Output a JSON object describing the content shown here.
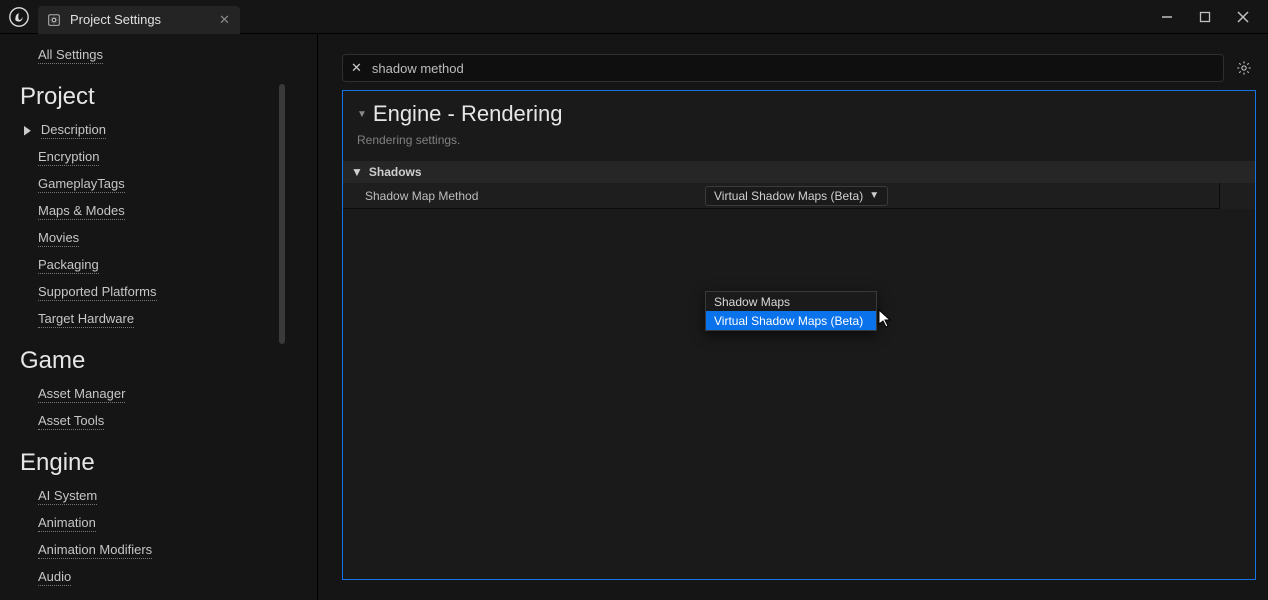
{
  "titlebar": {
    "tab_title": "Project Settings"
  },
  "sidebar": {
    "all_settings": "All Settings",
    "sections": [
      {
        "title": "Project",
        "items": [
          "Description",
          "Encryption",
          "GameplayTags",
          "Maps & Modes",
          "Movies",
          "Packaging",
          "Supported Platforms",
          "Target Hardware"
        ]
      },
      {
        "title": "Game",
        "items": [
          "Asset Manager",
          "Asset Tools"
        ]
      },
      {
        "title": "Engine",
        "items": [
          "AI System",
          "Animation",
          "Animation Modifiers",
          "Audio"
        ]
      }
    ]
  },
  "search": {
    "value": "shadow method"
  },
  "panel": {
    "title": "Engine - Rendering",
    "subtitle": "Rendering settings.",
    "category": "Shadows",
    "property_label": "Shadow Map Method",
    "dropdown_selected": "Virtual Shadow Maps (Beta)",
    "dropdown_options": [
      "Shadow Maps",
      "Virtual Shadow Maps (Beta)"
    ]
  }
}
